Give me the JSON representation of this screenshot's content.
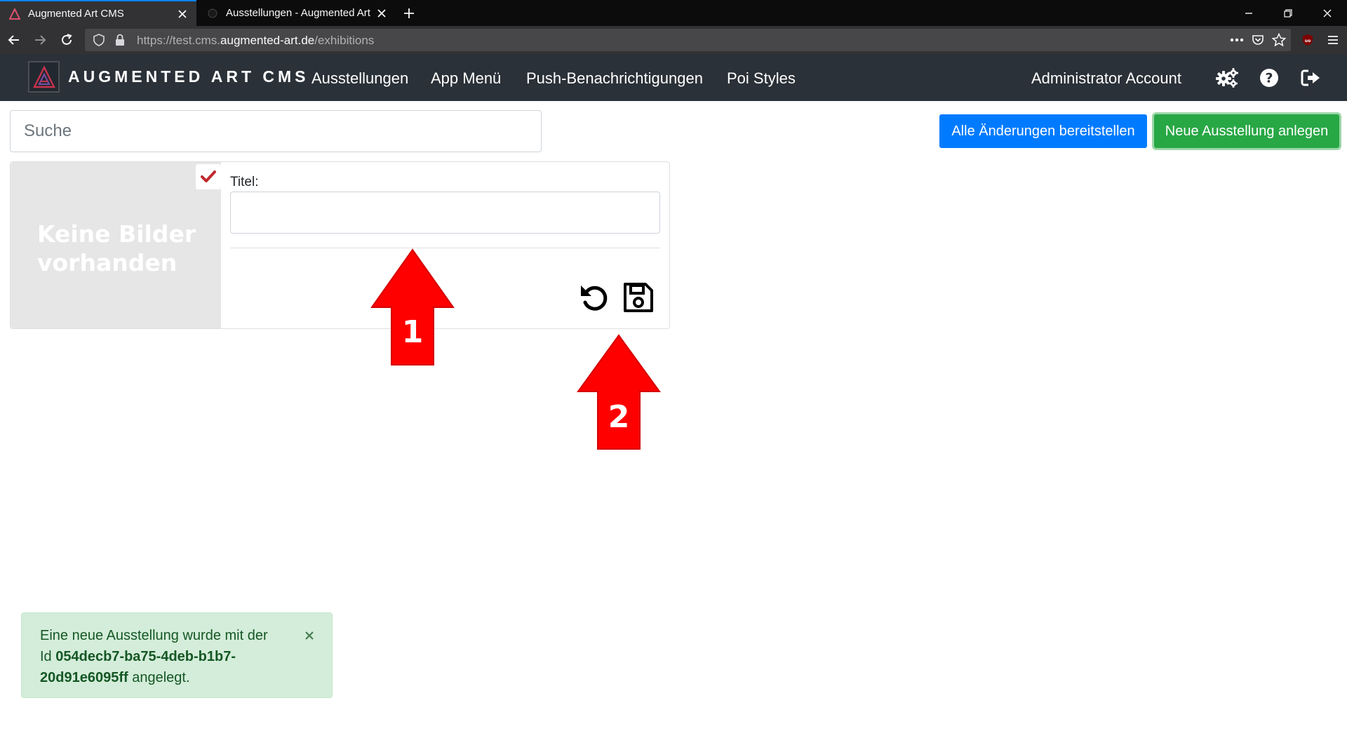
{
  "browser": {
    "tabs": [
      {
        "title": "Augmented Art CMS",
        "active": true
      },
      {
        "title": "Ausstellungen - Augmented Art",
        "active": false
      }
    ],
    "url": {
      "prefix": "https://test.cms.",
      "domain": "augmented-art.de",
      "path": "/exhibitions"
    },
    "accent_color": "#0a84ff"
  },
  "header": {
    "brand": "AUGMENTED ART CMS",
    "menu": [
      "Ausstellungen",
      "App Menü",
      "Push-Benachrichtigungen",
      "Poi Styles"
    ],
    "account": "Administrator Account",
    "icons": [
      "gears-icon",
      "help-icon",
      "logout-icon"
    ],
    "background": "#2b3138"
  },
  "toolbar": {
    "search_placeholder": "Suche",
    "deploy_label": "Alle Änderungen bereitstellen",
    "new_label": "Neue Ausstellung anlegen",
    "deploy_color": "#007bff",
    "new_color": "#28a745"
  },
  "card": {
    "no_images_line1": "Keine Bilder",
    "no_images_line2": "vorhanden",
    "title_label": "Titel:",
    "title_value": "",
    "icons": [
      "check-icon",
      "undo-icon",
      "save-icon"
    ],
    "check_color": "#c0282d"
  },
  "annotations": {
    "arrow_1": "1",
    "arrow_2": "2",
    "color": "#ff0000"
  },
  "toast": {
    "text_before": "Eine neue Ausstellung wurde mit der Id ",
    "id": "054decb7-ba75-4deb-b1b7-20d91e6095ff",
    "text_after": " angelegt.",
    "close_symbol": "×"
  }
}
